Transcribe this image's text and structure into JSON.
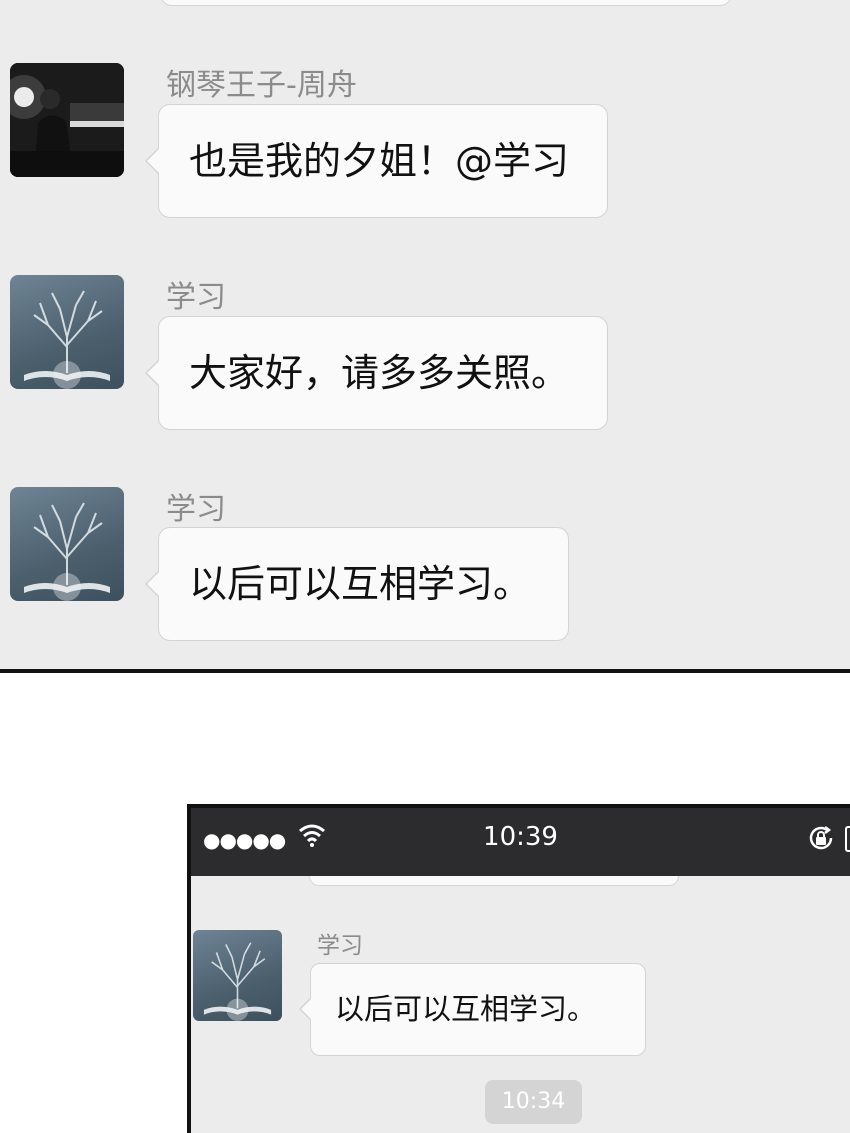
{
  "panel1": {
    "messages": [
      {
        "sender": "钢琴王子-周舟",
        "text": "也是我的夕姐！@学习",
        "avatar": "piano-player-photo"
      },
      {
        "sender": "学习",
        "text": "大家好，请多多关照。",
        "avatar": "tree-book-icon"
      },
      {
        "sender": "学习",
        "text": "以后可以互相学习。",
        "avatar": "tree-book-icon"
      }
    ]
  },
  "panel2": {
    "statusbar": {
      "signal": "●●●●●",
      "time": "10:39"
    },
    "message": {
      "sender": "学习",
      "text": "以后可以互相学习。",
      "avatar": "tree-book-icon"
    },
    "timestamp": "10:34"
  },
  "colors": {
    "chat_bg": "#ececec",
    "bubble_bg": "#fafafa",
    "sender_text": "#8b8b8b",
    "statusbar_bg": "#2c2c2e",
    "timestamp_bg": "#d4d4d4"
  }
}
